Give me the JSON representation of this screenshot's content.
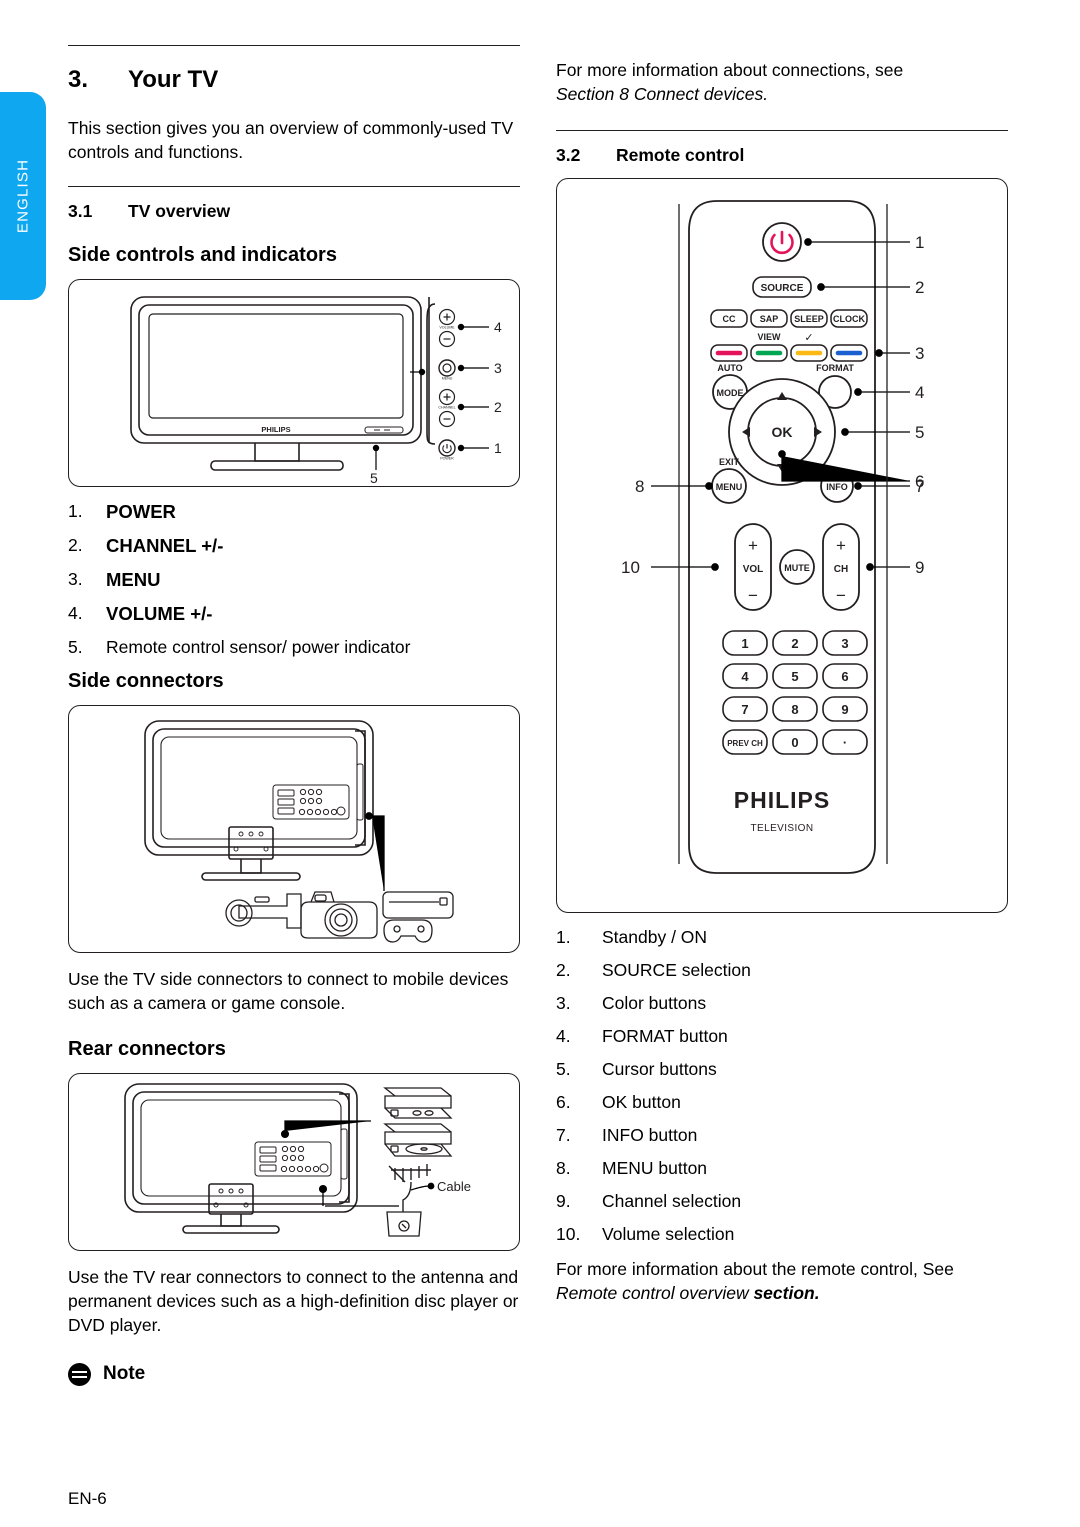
{
  "language_tab": {
    "label": "ENGLISH",
    "color": "#0fa7ef"
  },
  "page_number": "EN-6",
  "left_column": {
    "chapter": {
      "number": "3.",
      "title": "Your TV"
    },
    "intro": "This section gives you an overview of commonly-used TV controls and functions.",
    "section_31": {
      "number": "3.1",
      "title": "TV overview"
    },
    "heading_side_controls": "Side controls and indicators",
    "side_controls_figure": {
      "name": "tv-side-controls-diagram",
      "brand": "PHILIPS",
      "button_labels": [
        "VOLUME",
        "MENU",
        "CHANNEL",
        "POWER"
      ],
      "callouts": [
        "4",
        "3",
        "2",
        "1",
        "5"
      ]
    },
    "side_controls_list": [
      {
        "n": "1.",
        "label": "POWER",
        "bold": true
      },
      {
        "n": "2.",
        "label": "CHANNEL +/-",
        "bold": true
      },
      {
        "n": "3.",
        "label": "MENU",
        "bold": true
      },
      {
        "n": "4.",
        "label": "VOLUME +/-",
        "bold": true
      },
      {
        "n": "5.",
        "label": "Remote control sensor/ power indicator",
        "bold": false
      }
    ],
    "heading_side_connectors": "Side connectors",
    "side_connectors_figure": {
      "name": "tv-side-connectors-diagram",
      "devices": [
        "camcorder",
        "camera",
        "game-console"
      ]
    },
    "side_connectors_text": "Use the TV side connectors to connect to mobile devices such as a camera or game console.",
    "heading_rear_connectors": "Rear connectors",
    "rear_connectors_figure": {
      "name": "tv-rear-connectors-diagram",
      "cable_label": "Cable",
      "devices": [
        "hd-disc-player",
        "dvd-player",
        "antenna",
        "wall-socket"
      ]
    },
    "rear_connectors_text": "Use the TV rear connectors to connect to the antenna and permanent devices such as a high-definition disc player or DVD player.",
    "note_label": "Note"
  },
  "right_column": {
    "connections_note": "For more information about connections, see ",
    "connections_note_italic": "Section 8 Connect devices.",
    "section_32": {
      "number": "3.2",
      "title": "Remote control"
    },
    "remote_figure": {
      "name": "remote-control-diagram",
      "brand": "PHILIPS",
      "sub_brand": "TELEVISION",
      "power_button": "power-icon",
      "source_button": "SOURCE",
      "function_row": [
        "CC",
        "SAP",
        "SLEEP",
        "CLOCK"
      ],
      "color_buttons": [
        {
          "name": "red",
          "hex": "#e4145c",
          "tag": ""
        },
        {
          "name": "green",
          "hex": "#00a651",
          "tag": "VIEW"
        },
        {
          "name": "yellow",
          "hex": "#fdb913",
          "tag": "✓"
        },
        {
          "name": "blue",
          "hex": "#1b5fd0",
          "tag": ""
        }
      ],
      "auto_mode_top": "AUTO",
      "auto_mode_label": "MODE",
      "format_label": "FORMAT",
      "ok_label": "OK",
      "exit_top": "EXIT",
      "menu_label": "MENU",
      "info_label": "INFO",
      "vol_label": "VOL",
      "mute_label": "MUTE",
      "ch_label": "CH",
      "plus": "+",
      "minus": "−",
      "keypad": [
        "1",
        "2",
        "3",
        "4",
        "5",
        "6",
        "7",
        "8",
        "9",
        "PREV CH",
        "0",
        "·"
      ],
      "callouts": [
        "1",
        "2",
        "3",
        "4",
        "5",
        "6",
        "7",
        "8",
        "9",
        "10"
      ]
    },
    "remote_list": [
      {
        "n": "1.",
        "label": "Standby / ON"
      },
      {
        "n": "2.",
        "label": "SOURCE selection"
      },
      {
        "n": "3.",
        "label": "Color buttons"
      },
      {
        "n": "4.",
        "label": "FORMAT button"
      },
      {
        "n": "5.",
        "label": "Cursor buttons"
      },
      {
        "n": "6.",
        "label": "OK button"
      },
      {
        "n": "7.",
        "label": "INFO button"
      },
      {
        "n": "8.",
        "label": "MENU button"
      },
      {
        "n": "9.",
        "label": "Channel selection"
      },
      {
        "n": "10.",
        "label": "Volume selection"
      }
    ],
    "footer_text": "For more information about the remote control, See ",
    "footer_italic": "Remote control overview ",
    "footer_bold_italic": "section."
  }
}
